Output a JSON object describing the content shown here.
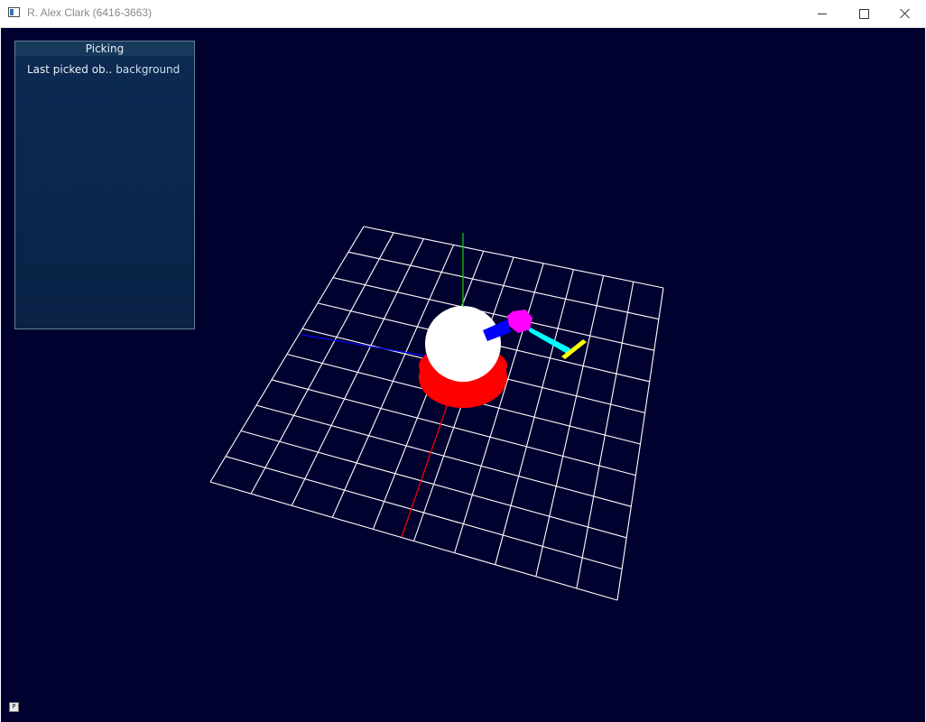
{
  "window": {
    "title": "R. Alex Clark (6416-3663)"
  },
  "panel": {
    "title": "Picking",
    "last_picked_label": "Last picked ob..",
    "last_picked_value": "background"
  },
  "scene": {
    "background_color": "#01012f",
    "grid_color": "#ffffff",
    "axis_colors": {
      "x": "#ff0000",
      "y": "#00c800",
      "z": "#0000ff"
    },
    "object_colors": {
      "base": "#ff0000",
      "sphere": "#ffffff",
      "arm_segment_1": "#0000ff",
      "joint": "#ff00ff",
      "arm_segment_2": "#00ffff",
      "end_effector": "#ffff00"
    }
  },
  "statusbar": {
    "icon": "small-window-icon",
    "icon_glyph": "P"
  }
}
